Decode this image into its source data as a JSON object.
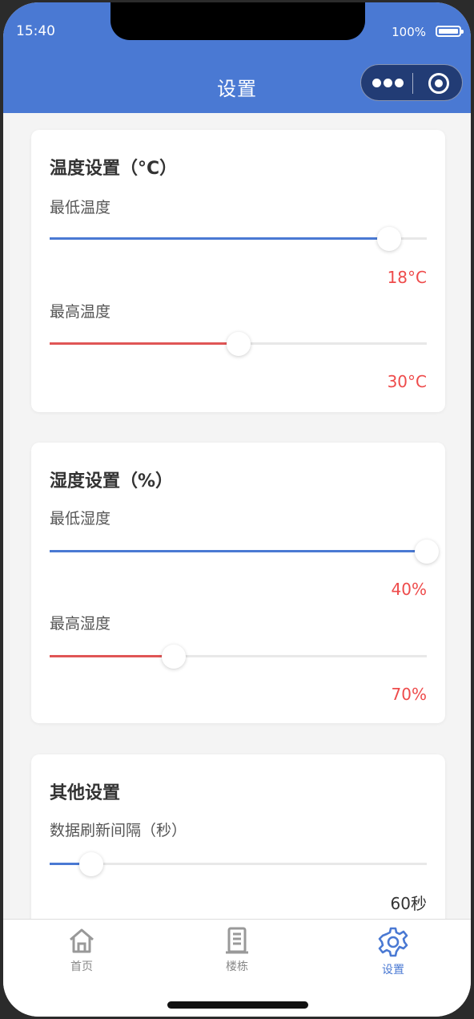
{
  "status_bar": {
    "time": "15:40",
    "battery": "100%"
  },
  "nav": {
    "title": "设置"
  },
  "colors": {
    "primary": "#4a79d3",
    "danger": "#ee4b4b"
  },
  "temperature": {
    "title": "温度设置（°C）",
    "min": {
      "label": "最低温度",
      "value_text": "18°C",
      "position_fraction": 0.9
    },
    "max": {
      "label": "最高温度",
      "value_text": "30°C",
      "position_fraction": 0.5
    }
  },
  "humidity": {
    "title": "湿度设置（%）",
    "min": {
      "label": "最低湿度",
      "value_text": "40%",
      "position_fraction": 1.0
    },
    "max": {
      "label": "最高湿度",
      "value_text": "70%",
      "position_fraction": 0.33
    }
  },
  "other": {
    "title": "其他设置",
    "refresh": {
      "label": "数据刷新间隔（秒）",
      "value_text": "60秒",
      "position_fraction": 0.11
    }
  },
  "tabbar": {
    "items": [
      {
        "label": "首页",
        "icon": "home-icon"
      },
      {
        "label": "楼栋",
        "icon": "building-icon"
      },
      {
        "label": "设置",
        "icon": "gear-icon",
        "active": true
      }
    ]
  }
}
